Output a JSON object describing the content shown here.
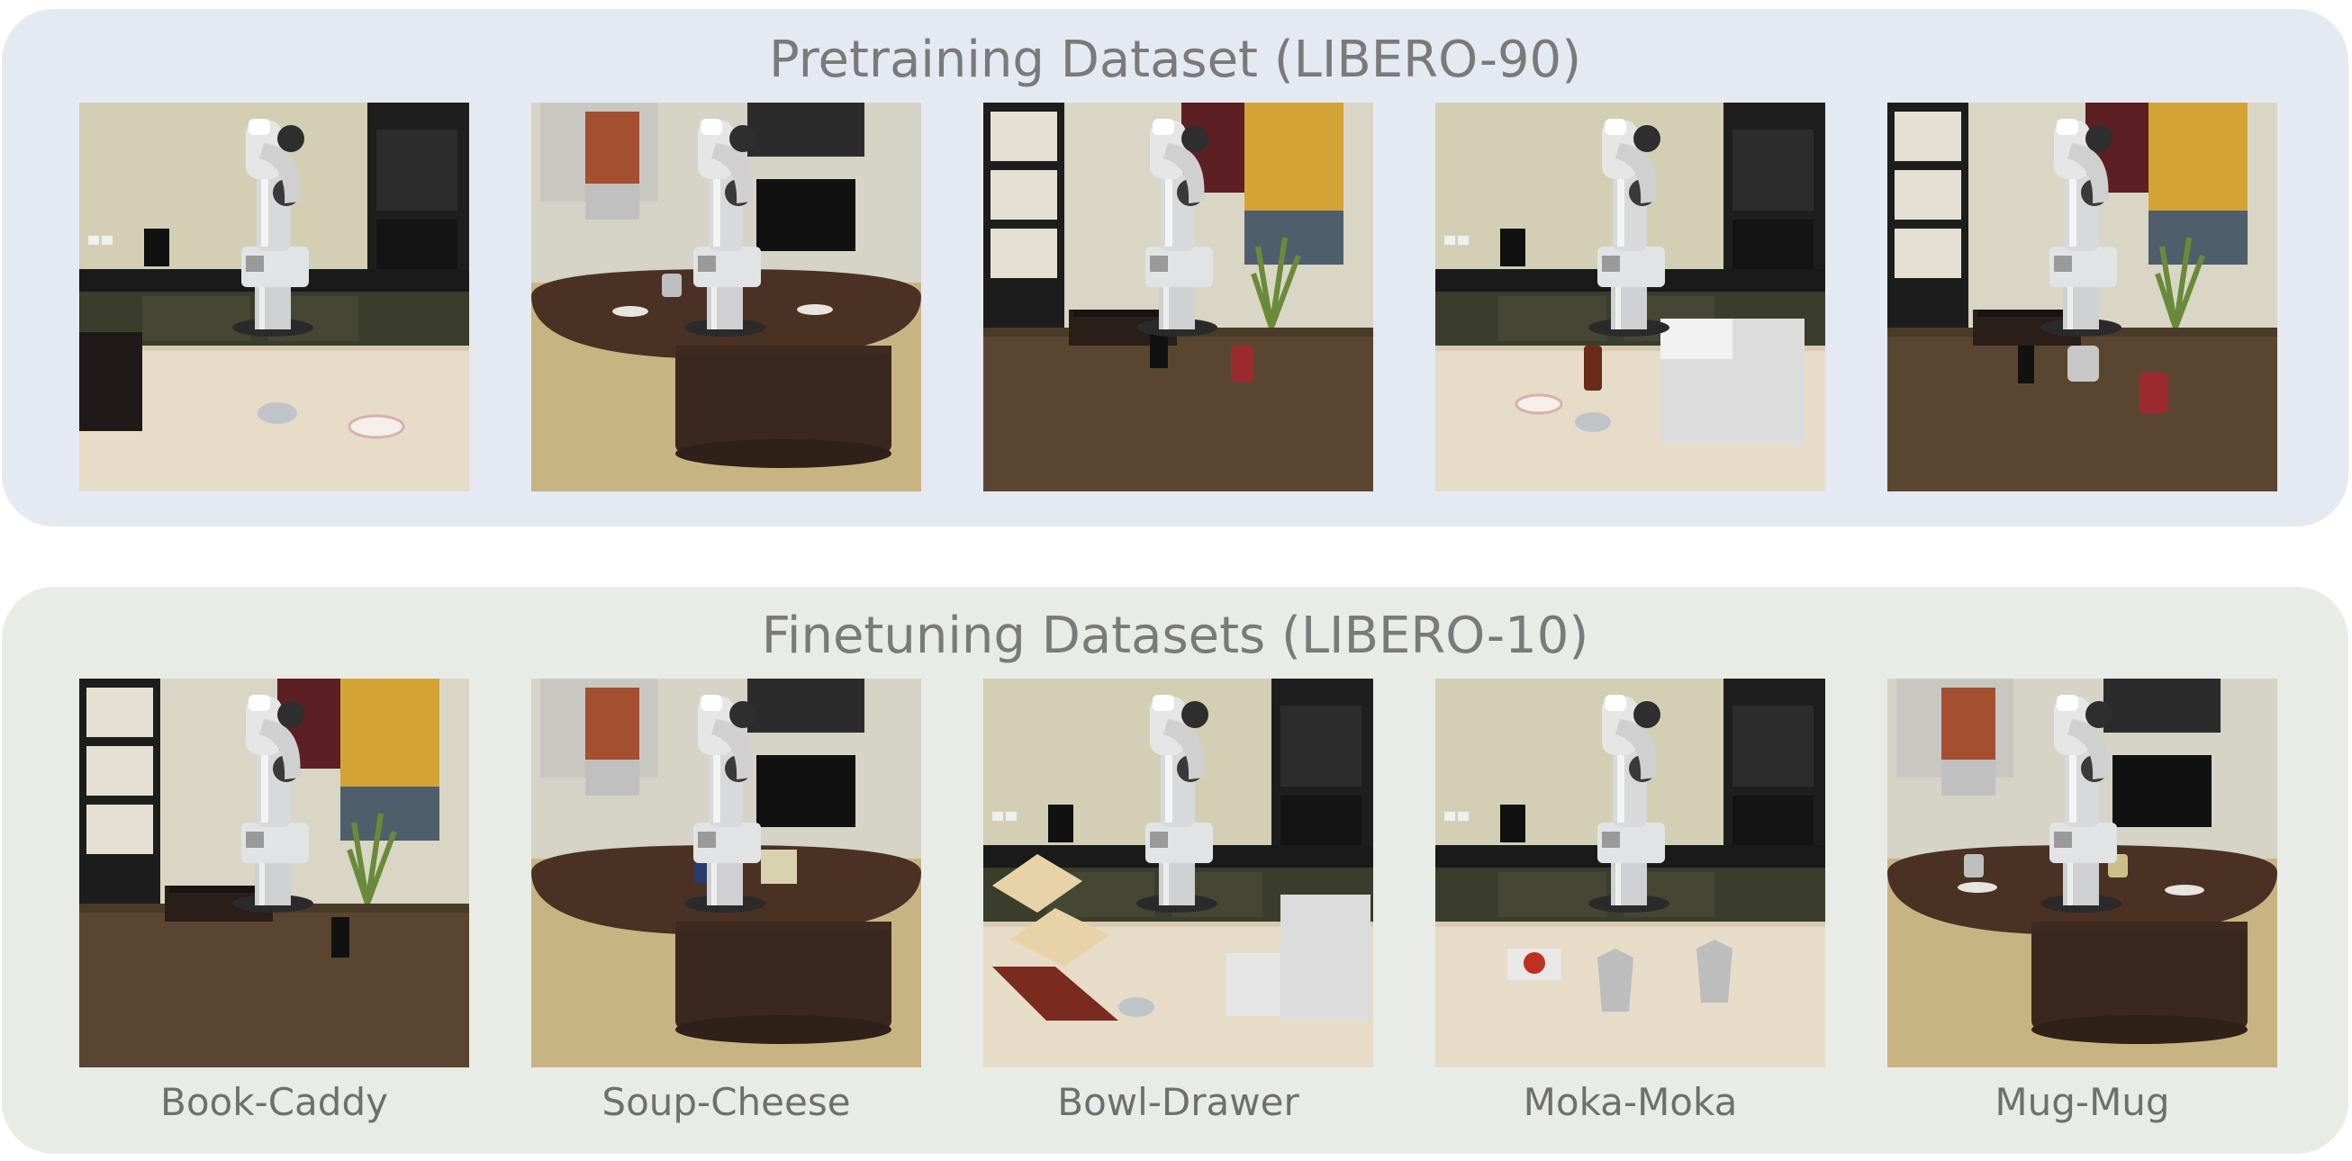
{
  "pretraining": {
    "title": "Pretraining Dataset (LIBERO-90)",
    "scenes": [
      {
        "scene": "kitchen"
      },
      {
        "scene": "living-room-oval-table"
      },
      {
        "scene": "study-shelf"
      },
      {
        "scene": "kitchen"
      },
      {
        "scene": "study-shelf"
      }
    ]
  },
  "finetuning": {
    "title": "Finetuning Datasets (LIBERO-10)",
    "tasks": [
      {
        "label": "Book-Caddy",
        "scene": "study-shelf"
      },
      {
        "label": "Soup-Cheese",
        "scene": "living-room-oval-table"
      },
      {
        "label": "Bowl-Drawer",
        "scene": "kitchen"
      },
      {
        "label": "Moka-Moka",
        "scene": "kitchen"
      },
      {
        "label": "Mug-Mug",
        "scene": "living-room-oval-table"
      }
    ]
  },
  "colors": {
    "pretraining_panel": "#e4e9f2",
    "finetuning_panel": "#e9ece6",
    "title_text": "#7a7a7a",
    "caption_text": "#6f6f6f"
  }
}
